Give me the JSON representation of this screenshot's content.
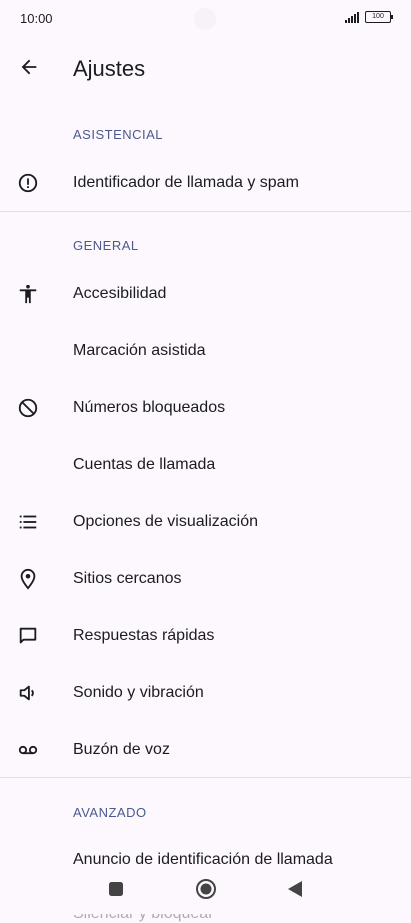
{
  "status_bar": {
    "time": "10:00",
    "battery": "100"
  },
  "app_bar": {
    "title": "Ajustes"
  },
  "sections": {
    "asistencial": {
      "header": "ASISTENCIAL",
      "items": [
        {
          "label": "Identificador de llamada y spam",
          "icon": "alert-circle-icon"
        }
      ]
    },
    "general": {
      "header": "GENERAL",
      "items": [
        {
          "label": "Accesibilidad",
          "icon": "accessibility-icon"
        },
        {
          "label": "Marcación asistida",
          "icon": ""
        },
        {
          "label": "Números bloqueados",
          "icon": "block-icon"
        },
        {
          "label": "Cuentas de llamada",
          "icon": ""
        },
        {
          "label": "Opciones de visualización",
          "icon": "list-icon"
        },
        {
          "label": "Sitios cercanos",
          "icon": "location-pin-icon"
        },
        {
          "label": "Respuestas rápidas",
          "icon": "chat-bubble-icon"
        },
        {
          "label": "Sonido y vibración",
          "icon": "speaker-icon"
        },
        {
          "label": "Buzón de voz",
          "icon": "voicemail-icon"
        }
      ]
    },
    "avanzado": {
      "header": "AVANZADO",
      "items": [
        {
          "label": "Anuncio de identificación de llamada",
          "icon": ""
        },
        {
          "label": "Silenciar y bloquear",
          "icon": ""
        }
      ]
    }
  },
  "nav_bar": {
    "items": [
      "recents-icon",
      "home-icon",
      "back-icon"
    ]
  }
}
